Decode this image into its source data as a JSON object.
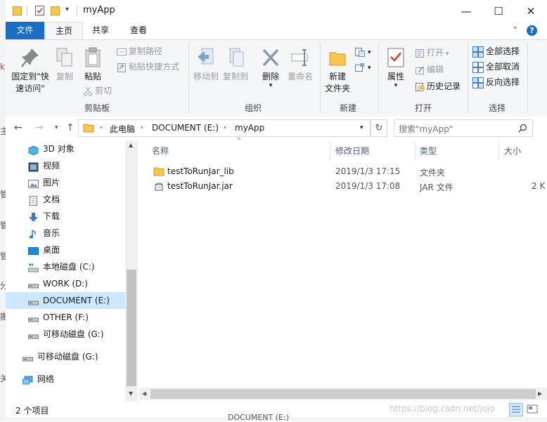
{
  "behind_window": {
    "chars": [
      "k",
      "主",
      "管",
      "管",
      "管",
      "分",
      "搬",
      "关"
    ]
  },
  "window": {
    "title": "myApp",
    "controls": {
      "minimize": "—",
      "maximize": "☐",
      "close": "✕"
    },
    "help": "?",
    "tabs": [
      {
        "label": "文件"
      },
      {
        "label": "主页"
      },
      {
        "label": "共享"
      },
      {
        "label": "查看"
      }
    ]
  },
  "ribbon": {
    "clipboard": {
      "group_label": "剪贴板",
      "pin_line1": "固定到\"快",
      "pin_line2": "速访问\"",
      "copy": "复制",
      "paste": "粘贴",
      "copy_path": "复制路径",
      "paste_shortcut": "粘贴快捷方式",
      "cut": "剪切"
    },
    "organize": {
      "group_label": "组织",
      "move_to": "移动到",
      "copy_to": "复制到",
      "delete": "删除",
      "rename": "重命名"
    },
    "new": {
      "group_label": "新建",
      "new_folder_line1": "新建",
      "new_folder_line2": "文件夹"
    },
    "open": {
      "group_label": "打开",
      "properties": "属性",
      "open": "打开",
      "edit": "编辑",
      "history": "历史记录"
    },
    "select": {
      "group_label": "选择",
      "select_all": "全部选择",
      "select_none": "全部取消",
      "invert": "反向选择"
    }
  },
  "address": {
    "crumbs": [
      "此电脑",
      "DOCUMENT (E:)",
      "myApp"
    ],
    "search_placeholder": "搜索\"myApp\""
  },
  "sidebar": {
    "items": [
      {
        "label": "3D 对象",
        "icon": "3d-objects-icon"
      },
      {
        "label": "视频",
        "icon": "video-icon"
      },
      {
        "label": "图片",
        "icon": "pictures-icon"
      },
      {
        "label": "文档",
        "icon": "documents-icon"
      },
      {
        "label": "下载",
        "icon": "download-icon"
      },
      {
        "label": "音乐",
        "icon": "music-icon"
      },
      {
        "label": "桌面",
        "icon": "desktop-icon"
      },
      {
        "label": "本地磁盘 (C:)",
        "icon": "drive-c-icon"
      },
      {
        "label": "WORK (D:)",
        "icon": "drive-icon"
      },
      {
        "label": "DOCUMENT (E:)",
        "icon": "drive-icon",
        "selected": true
      },
      {
        "label": "OTHER (F:)",
        "icon": "drive-icon"
      },
      {
        "label": "可移动磁盘 (G:)",
        "icon": "drive-icon"
      },
      {
        "label": "可移动磁盘 (G:)",
        "icon": "drive-icon"
      },
      {
        "label": "网络",
        "icon": "network-icon"
      }
    ]
  },
  "files": {
    "columns": [
      "名称",
      "修改日期",
      "类型",
      "大小"
    ],
    "rows": [
      {
        "name": "testToRunJar_lib",
        "date": "2019/1/3 17:15",
        "type": "文件夹",
        "size": "",
        "icon": "folder-icon"
      },
      {
        "name": "testToRunJar.jar",
        "date": "2019/1/3 17:08",
        "type": "JAR 文件",
        "size": "2 K",
        "icon": "jar-file-icon"
      }
    ]
  },
  "status": {
    "item_count": "2 个项目",
    "watermark": "https://blog.csdn.net/jojo"
  },
  "taskbar_peek": "DOCUMENT (E:)",
  "colors": {
    "accent": "#1a6dc2",
    "selection": "#cce8ff",
    "ribbon_bg": "#f5f6f7",
    "folder": "#f7c750"
  }
}
